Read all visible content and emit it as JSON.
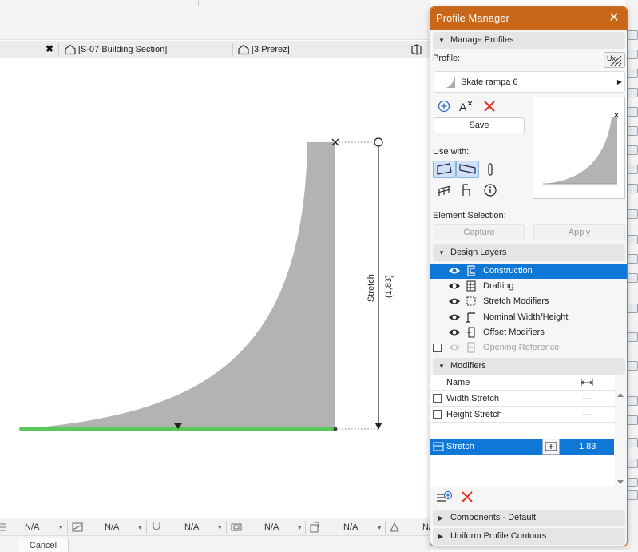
{
  "tabs": [
    {
      "label": "[S-07 Building Section]"
    },
    {
      "label": "[3 Prerez]"
    },
    {
      "label": ""
    }
  ],
  "canvas": {
    "dim_label": "Stretch",
    "dim_value": "(1,83)"
  },
  "statusbar": {
    "items": [
      "N/A",
      "N/A",
      "N/A",
      "N/A",
      "N/A",
      "N/A"
    ]
  },
  "cancel_label": "Cancel",
  "palette": {
    "title": "Profile Manager",
    "manage_header": "Manage Profiles",
    "profile_label": "Profile:",
    "profile_name": "Skate rampa 6",
    "save_label": "Save",
    "use_with_label": "Use with:",
    "element_selection_label": "Element Selection:",
    "capture_label": "Capture",
    "apply_label": "Apply",
    "design_layers_header": "Design Layers",
    "layers": [
      {
        "name": "Construction",
        "selected": true,
        "visible": true
      },
      {
        "name": "Drafting",
        "selected": false,
        "visible": true
      },
      {
        "name": "Stretch Modifiers",
        "selected": false,
        "visible": true
      },
      {
        "name": "Nominal Width/Height",
        "selected": false,
        "visible": true
      },
      {
        "name": "Offset Modifiers",
        "selected": false,
        "visible": true
      },
      {
        "name": "Opening Reference",
        "selected": false,
        "visible": false
      }
    ],
    "modifiers_header": "Modifiers",
    "modifiers_col_name": "Name",
    "modifiers": [
      {
        "name": "Width Stretch",
        "value": "---"
      },
      {
        "name": "Height Stretch",
        "value": "---"
      }
    ],
    "stretch_row": {
      "name": "Stretch",
      "value": "1.83"
    },
    "components_header": "Components - Default",
    "uniform_header": "Uniform Profile Contours"
  },
  "colors": {
    "palette_title_bg": "#c8671a",
    "selection_blue": "#0f78d6",
    "profile_fill": "#b3b3b3",
    "baseline_green": "#5cc85c",
    "delete_red": "#e0301e"
  }
}
